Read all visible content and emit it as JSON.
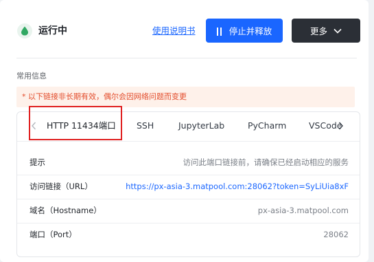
{
  "header": {
    "status_text": "运行中",
    "status_icon": "water-drop-icon",
    "status_color": "#31a863",
    "manual_link": "使用说明书",
    "stop_button": "停止并释放",
    "more_button": "更多"
  },
  "section": {
    "title": "常用信息",
    "notice": "* 以下链接非长期有效，偶尔会因网络问题而变更"
  },
  "tabs": [
    {
      "label": "HTTP 11434端口",
      "active": true
    },
    {
      "label": "SSH"
    },
    {
      "label": "JupyterLab"
    },
    {
      "label": "PyCharm"
    },
    {
      "label": "VSCode"
    }
  ],
  "rows": [
    {
      "label": "提示",
      "value": "访问此端口链接前，请确保已经启动相应的服务"
    },
    {
      "label": "访问链接（URL）",
      "value": "https://px-asia-3.matpool.com:28062?token=SyLiUia8xF"
    },
    {
      "label": "域名（Hostname）",
      "value": "px-asia-3.matpool.com"
    },
    {
      "label": "端口（Port）",
      "value": "28062"
    }
  ],
  "colors": {
    "primary": "#1a66ff",
    "dark_button": "#2b2f36",
    "notice_text": "#e34d2c",
    "notice_bg": "#fef1ea",
    "highlight_box": "#e02020"
  }
}
